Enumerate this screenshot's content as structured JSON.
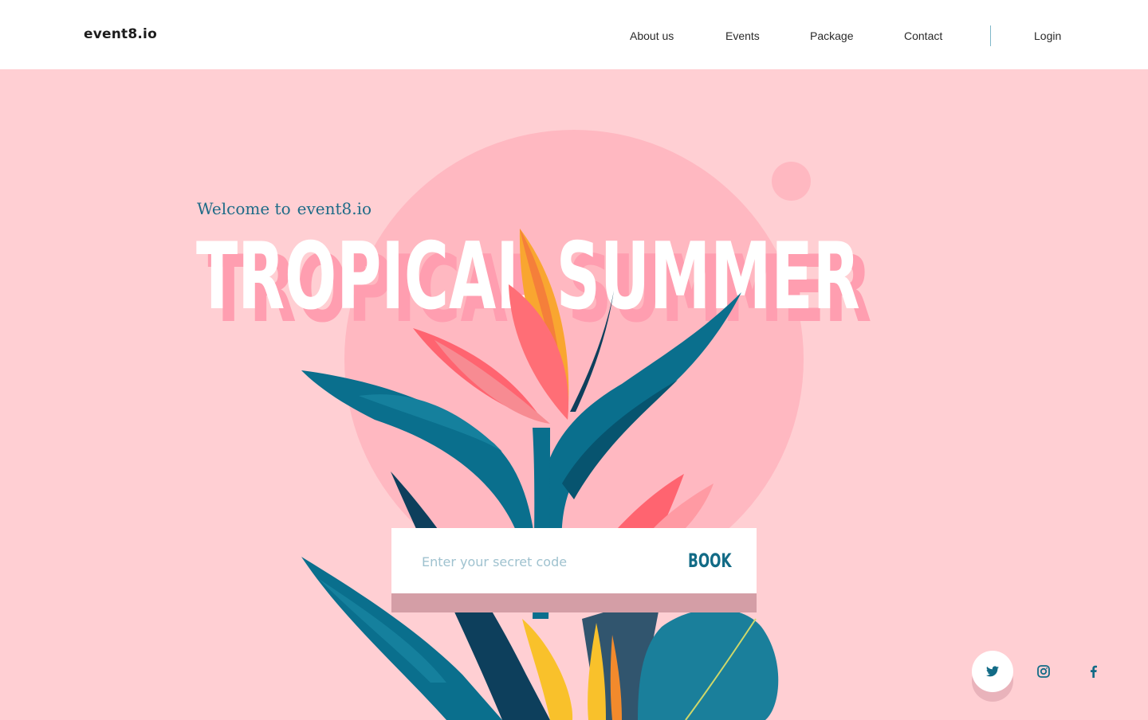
{
  "header": {
    "logo": "event8.io",
    "nav": [
      {
        "label": "About us"
      },
      {
        "label": "Events"
      },
      {
        "label": "Package"
      },
      {
        "label": "Contact"
      }
    ],
    "login": "Login"
  },
  "hero": {
    "welcome_prefix": "Welcome to",
    "welcome_brand": "event8.io",
    "headline": "TROPICAL SUMMER"
  },
  "booking": {
    "placeholder": "Enter your secret code",
    "value": "",
    "button_label": "BOOK"
  },
  "social": [
    {
      "icon": "twitter-icon",
      "active": true
    },
    {
      "icon": "instagram-icon",
      "active": false
    },
    {
      "icon": "facebook-icon",
      "active": false
    }
  ],
  "colors": {
    "background": "#ffcfd3",
    "circle": "#ffb8c1",
    "accent_teal": "#126b86",
    "headline_shadow": "#ff9eb0"
  }
}
